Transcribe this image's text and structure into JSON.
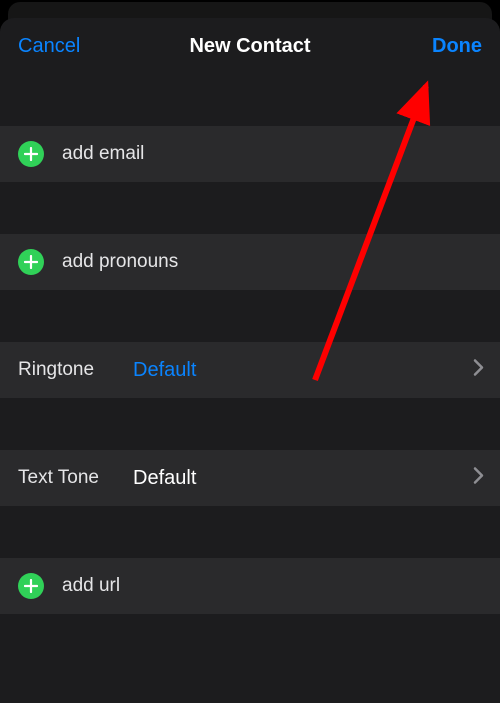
{
  "header": {
    "cancel": "Cancel",
    "title": "New Contact",
    "done": "Done"
  },
  "rows": {
    "add_email": "add email",
    "add_pronouns": "add pronouns",
    "ringtone_label": "Ringtone",
    "ringtone_value": "Default",
    "texttone_label": "Text Tone",
    "texttone_value": "Default",
    "add_url": "add url"
  },
  "colors": {
    "link": "#0a84ff",
    "add_green": "#30d158",
    "row_bg": "#2a2a2c",
    "sheet_bg": "#1c1c1e"
  }
}
